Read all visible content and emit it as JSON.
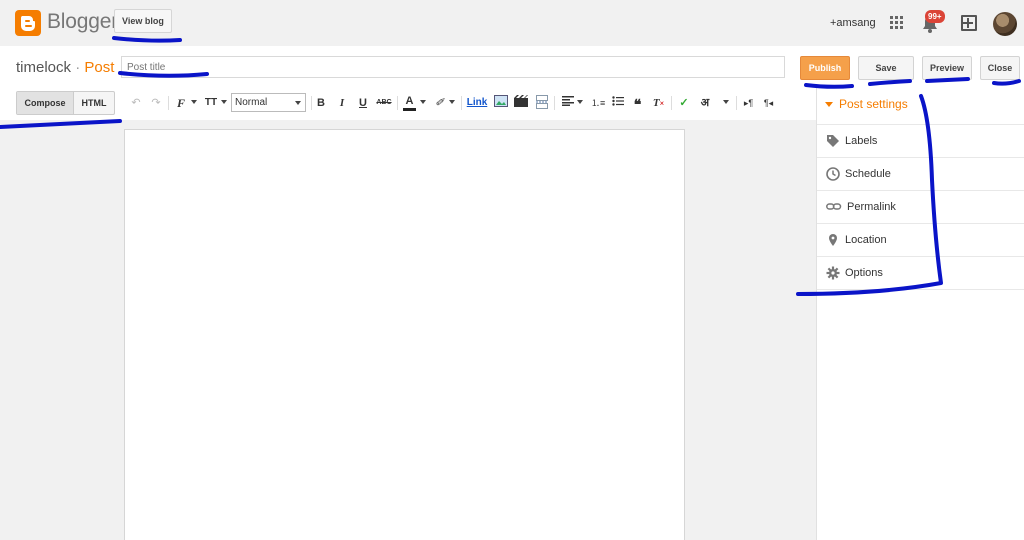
{
  "topbar": {
    "brand": "Blogger",
    "view_blog_label": "View blog",
    "user_label": "+amsang",
    "notification_count": "99+",
    "icons": [
      "blogger-logo-icon",
      "apps-grid-icon",
      "bell-icon",
      "new-post-plus-icon",
      "avatar"
    ]
  },
  "titlerow": {
    "blog_name": "timelock",
    "separator": "·",
    "section": "Post",
    "title_placeholder": "Post title",
    "title_value": "",
    "publish_label": "Publish",
    "save_label": "Save",
    "preview_label": "Preview",
    "close_label": "Close"
  },
  "toolbar": {
    "compose_label": "Compose",
    "html_label": "HTML",
    "format_select_value": "Normal",
    "bold_label": "B",
    "italic_label": "I",
    "underline_label": "U",
    "strike_label": "ABC",
    "text_color_label": "A",
    "link_label": "Link",
    "transliterate_label": "अ",
    "font_size_label": "TT"
  },
  "sidebar": {
    "heading": "Post settings",
    "items": [
      {
        "label": "Labels",
        "icon": "tag-icon"
      },
      {
        "label": "Schedule",
        "icon": "clock-icon"
      },
      {
        "label": "Permalink",
        "icon": "chain-link-icon"
      },
      {
        "label": "Location",
        "icon": "map-pin-icon"
      },
      {
        "label": "Options",
        "icon": "gear-icon"
      }
    ]
  },
  "colors": {
    "accent": "#f57d00",
    "publish_bg": "#f5a04a",
    "annotation_pen": "#0a14c8",
    "link": "#1155cc"
  }
}
